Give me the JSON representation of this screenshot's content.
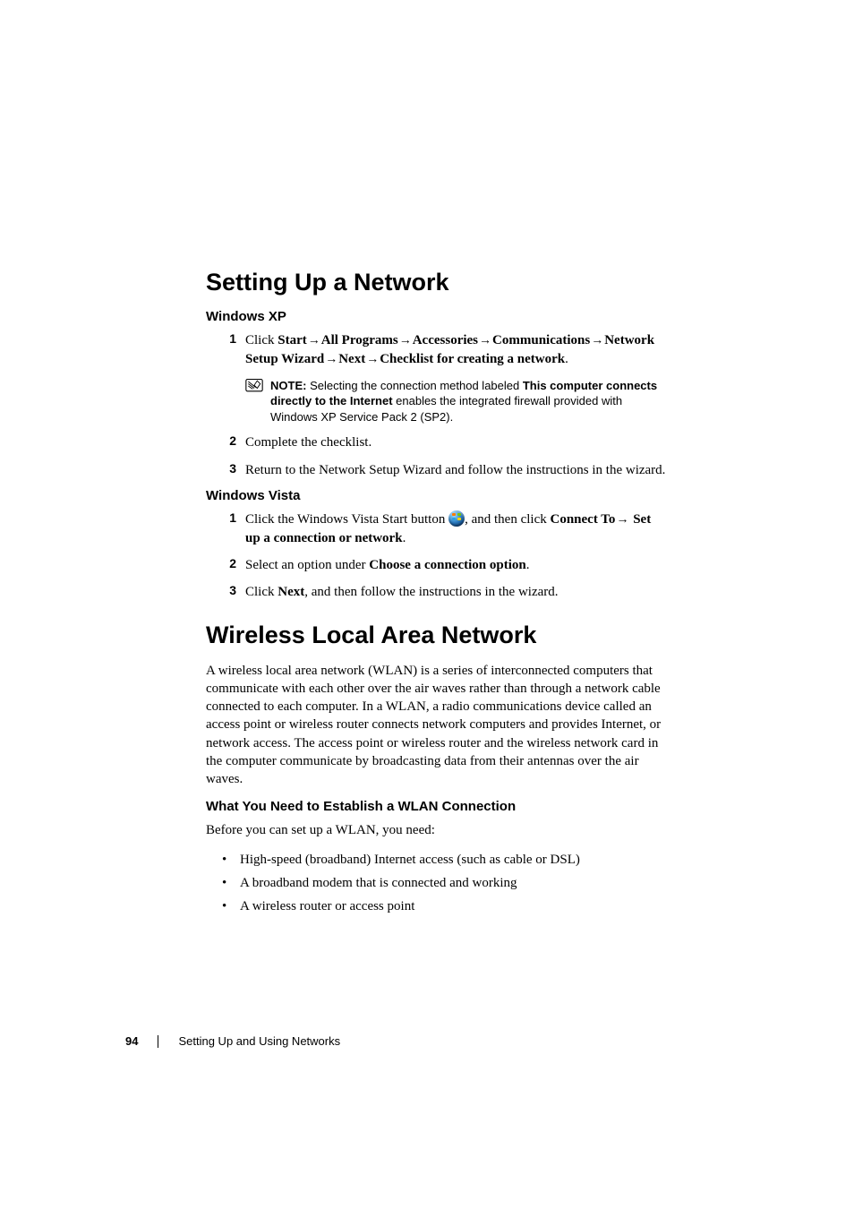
{
  "heading1": "Setting Up a Network",
  "winxp": {
    "title": "Windows XP",
    "step1_parts": [
      "Click ",
      "Start",
      "All Programs",
      "Accessories",
      "Communications",
      "Network Setup Wizard",
      "Next",
      "Checklist for creating a network",
      "."
    ],
    "note_label": "NOTE:",
    "note_text_pre": " Selecting the connection method labeled ",
    "note_text_bold": "This computer connects directly to the Internet",
    "note_text_post": " enables the integrated firewall provided with Windows XP Service Pack 2 (SP2).",
    "step2": "Complete the checklist.",
    "step3": "Return to the Network Setup Wizard and follow the instructions in the wizard."
  },
  "vista": {
    "title": "Windows Vista",
    "step1_pre": "Click the Windows Vista Start button ",
    "step1_mid": ",  and then click ",
    "step1_bold1": "Connect To",
    "step1_bold2": "Set up a connection or network",
    "step1_end": ".",
    "step2_pre": "Select an option under ",
    "step2_bold": "Choose a connection option",
    "step2_end": ".",
    "step3_pre": "Click ",
    "step3_bold": "Next",
    "step3_end": ", and then follow the instructions in the wizard."
  },
  "heading2": "Wireless Local Area Network",
  "wlan_para": "A wireless local area network (WLAN) is a series of interconnected computers that communicate with each other over the air waves rather than through a network cable connected to each computer. In a WLAN, a radio communications device called an access point or wireless router connects network computers and provides Internet, or network access. The access point or wireless router and the wireless network card in the computer communicate by broadcasting data from their antennas over the air waves.",
  "wlan_sub": "What You Need to Establish a WLAN Connection",
  "wlan_lead": "Before you can set up a WLAN, you need:",
  "wlan_bullets": [
    "High-speed (broadband) Internet access (such as cable or DSL)",
    "A broadband modem that is connected and working",
    "A wireless router or access point"
  ],
  "footer": {
    "page": "94",
    "section": "Setting Up and Using Networks"
  },
  "nums": {
    "1": "1",
    "2": "2",
    "3": "3"
  }
}
